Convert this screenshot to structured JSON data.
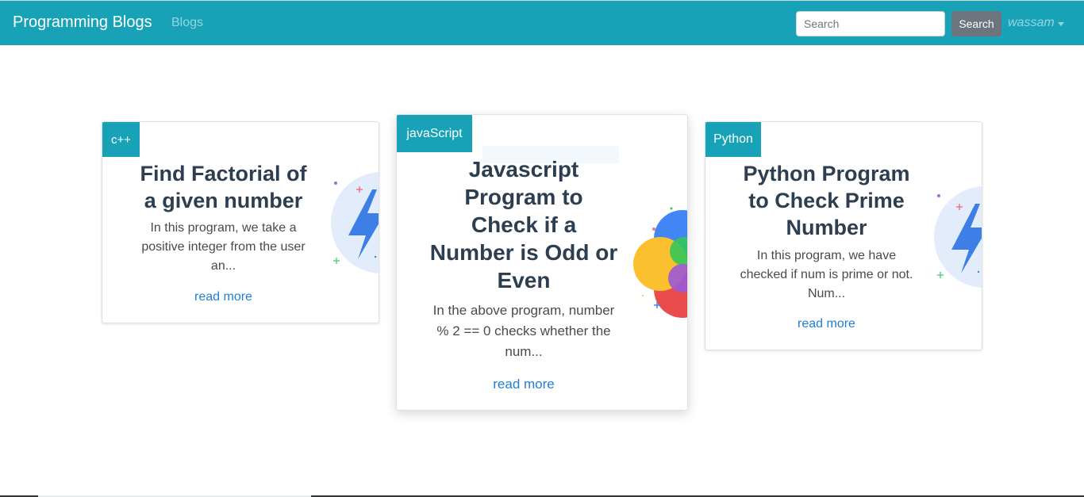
{
  "navbar": {
    "brand": "Programming Blogs",
    "nav_link": "Blogs",
    "search_placeholder": "Search",
    "search_button": "Search",
    "user": "wassam",
    "color": "#17a2b8"
  },
  "cards": [
    {
      "tag": "c++",
      "title": "Find Factorial of a given number",
      "excerpt": "In this program, we take a positive integer from the user an...",
      "link": "read more",
      "icon": "lightning-icon"
    },
    {
      "tag": "javaScript",
      "title": "Javascript Program to Check if a Number is Odd or Even",
      "excerpt": "In the above program, number % 2 == 0 checks whether the num...",
      "link": "read more",
      "icon": "color-circles-icon"
    },
    {
      "tag": "Python",
      "title": "Python Program to Check Prime Number",
      "excerpt": "In this program, we have checked if num is prime or not. Num...",
      "link": "read more",
      "icon": "lightning-icon"
    }
  ]
}
